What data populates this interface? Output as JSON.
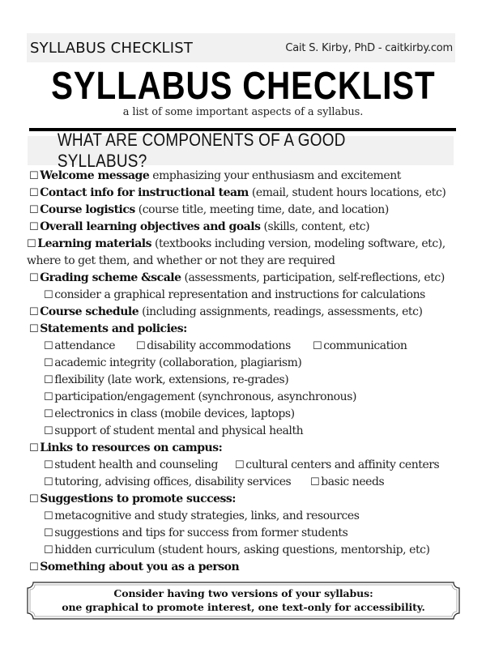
{
  "header": {
    "short_title": "SYLLABUS CHECKLIST",
    "author": "Cait S. Kirby, PhD - caitkirby.com"
  },
  "title": "SYLLABUS CHECKLIST",
  "subtitle": "a list of some important aspects of a syllabus.",
  "section_heading": "WHAT ARE COMPONENTS OF A GOOD SYLLABUS?",
  "checkbox_glyph": "☐",
  "items": {
    "welcome": {
      "bold": "Welcome message",
      "rest": " emphasizing your enthusiasm and excitement"
    },
    "contact": {
      "bold": "Contact info for instructional team",
      "rest": " (email, student hours locations, etc)"
    },
    "logistics": {
      "bold": "Course logistics",
      "rest": " (course title, meeting time, date, and location)"
    },
    "objectives": {
      "bold": "Overall learning objectives and goals",
      "rest": " (skills, content, etc)"
    },
    "materials": {
      "bold": "Learning materials",
      "rest": " (textbooks including version, modeling software, etc), where to get them, and whether or not they are required"
    },
    "grading": {
      "bold": "Grading scheme &scale",
      "rest": " (assessments, participation, self-reflections, etc)"
    },
    "grading_sub": "consider a graphical representation and instructions for calculations",
    "schedule": {
      "bold": "Course schedule",
      "rest": " (including assignments, readings, assessments, etc)"
    },
    "statements": {
      "bold": "Statements and policies:",
      "row1": [
        "attendance",
        "disability accommodations",
        "communication"
      ],
      "subs": [
        "academic integrity (collaboration, plagiarism)",
        "flexibility (late work, extensions, re-grades)",
        "participation/engagement (synchronous, asynchronous)",
        "electronics in class (mobile devices, laptops)",
        "support of student mental and physical health"
      ]
    },
    "resources": {
      "bold": "Links to resources on campus:",
      "row1": [
        "student health and counseling",
        "cultural centers and affinity centers"
      ],
      "row2": [
        "tutoring, advising offices, disability services",
        "basic needs"
      ]
    },
    "success": {
      "bold": "Suggestions to promote success:",
      "subs": [
        "metacognitive and study strategies, links, and resources",
        "suggestions and tips for success from former students",
        "hidden curriculum (student hours, asking questions, mentorship, etc)"
      ]
    },
    "person": {
      "bold": "Something about you as a person"
    }
  },
  "footer": {
    "line1": "Consider having two versions of your syllabus:",
    "line2": "one graphical to promote interest, one text-only for accessibility."
  }
}
